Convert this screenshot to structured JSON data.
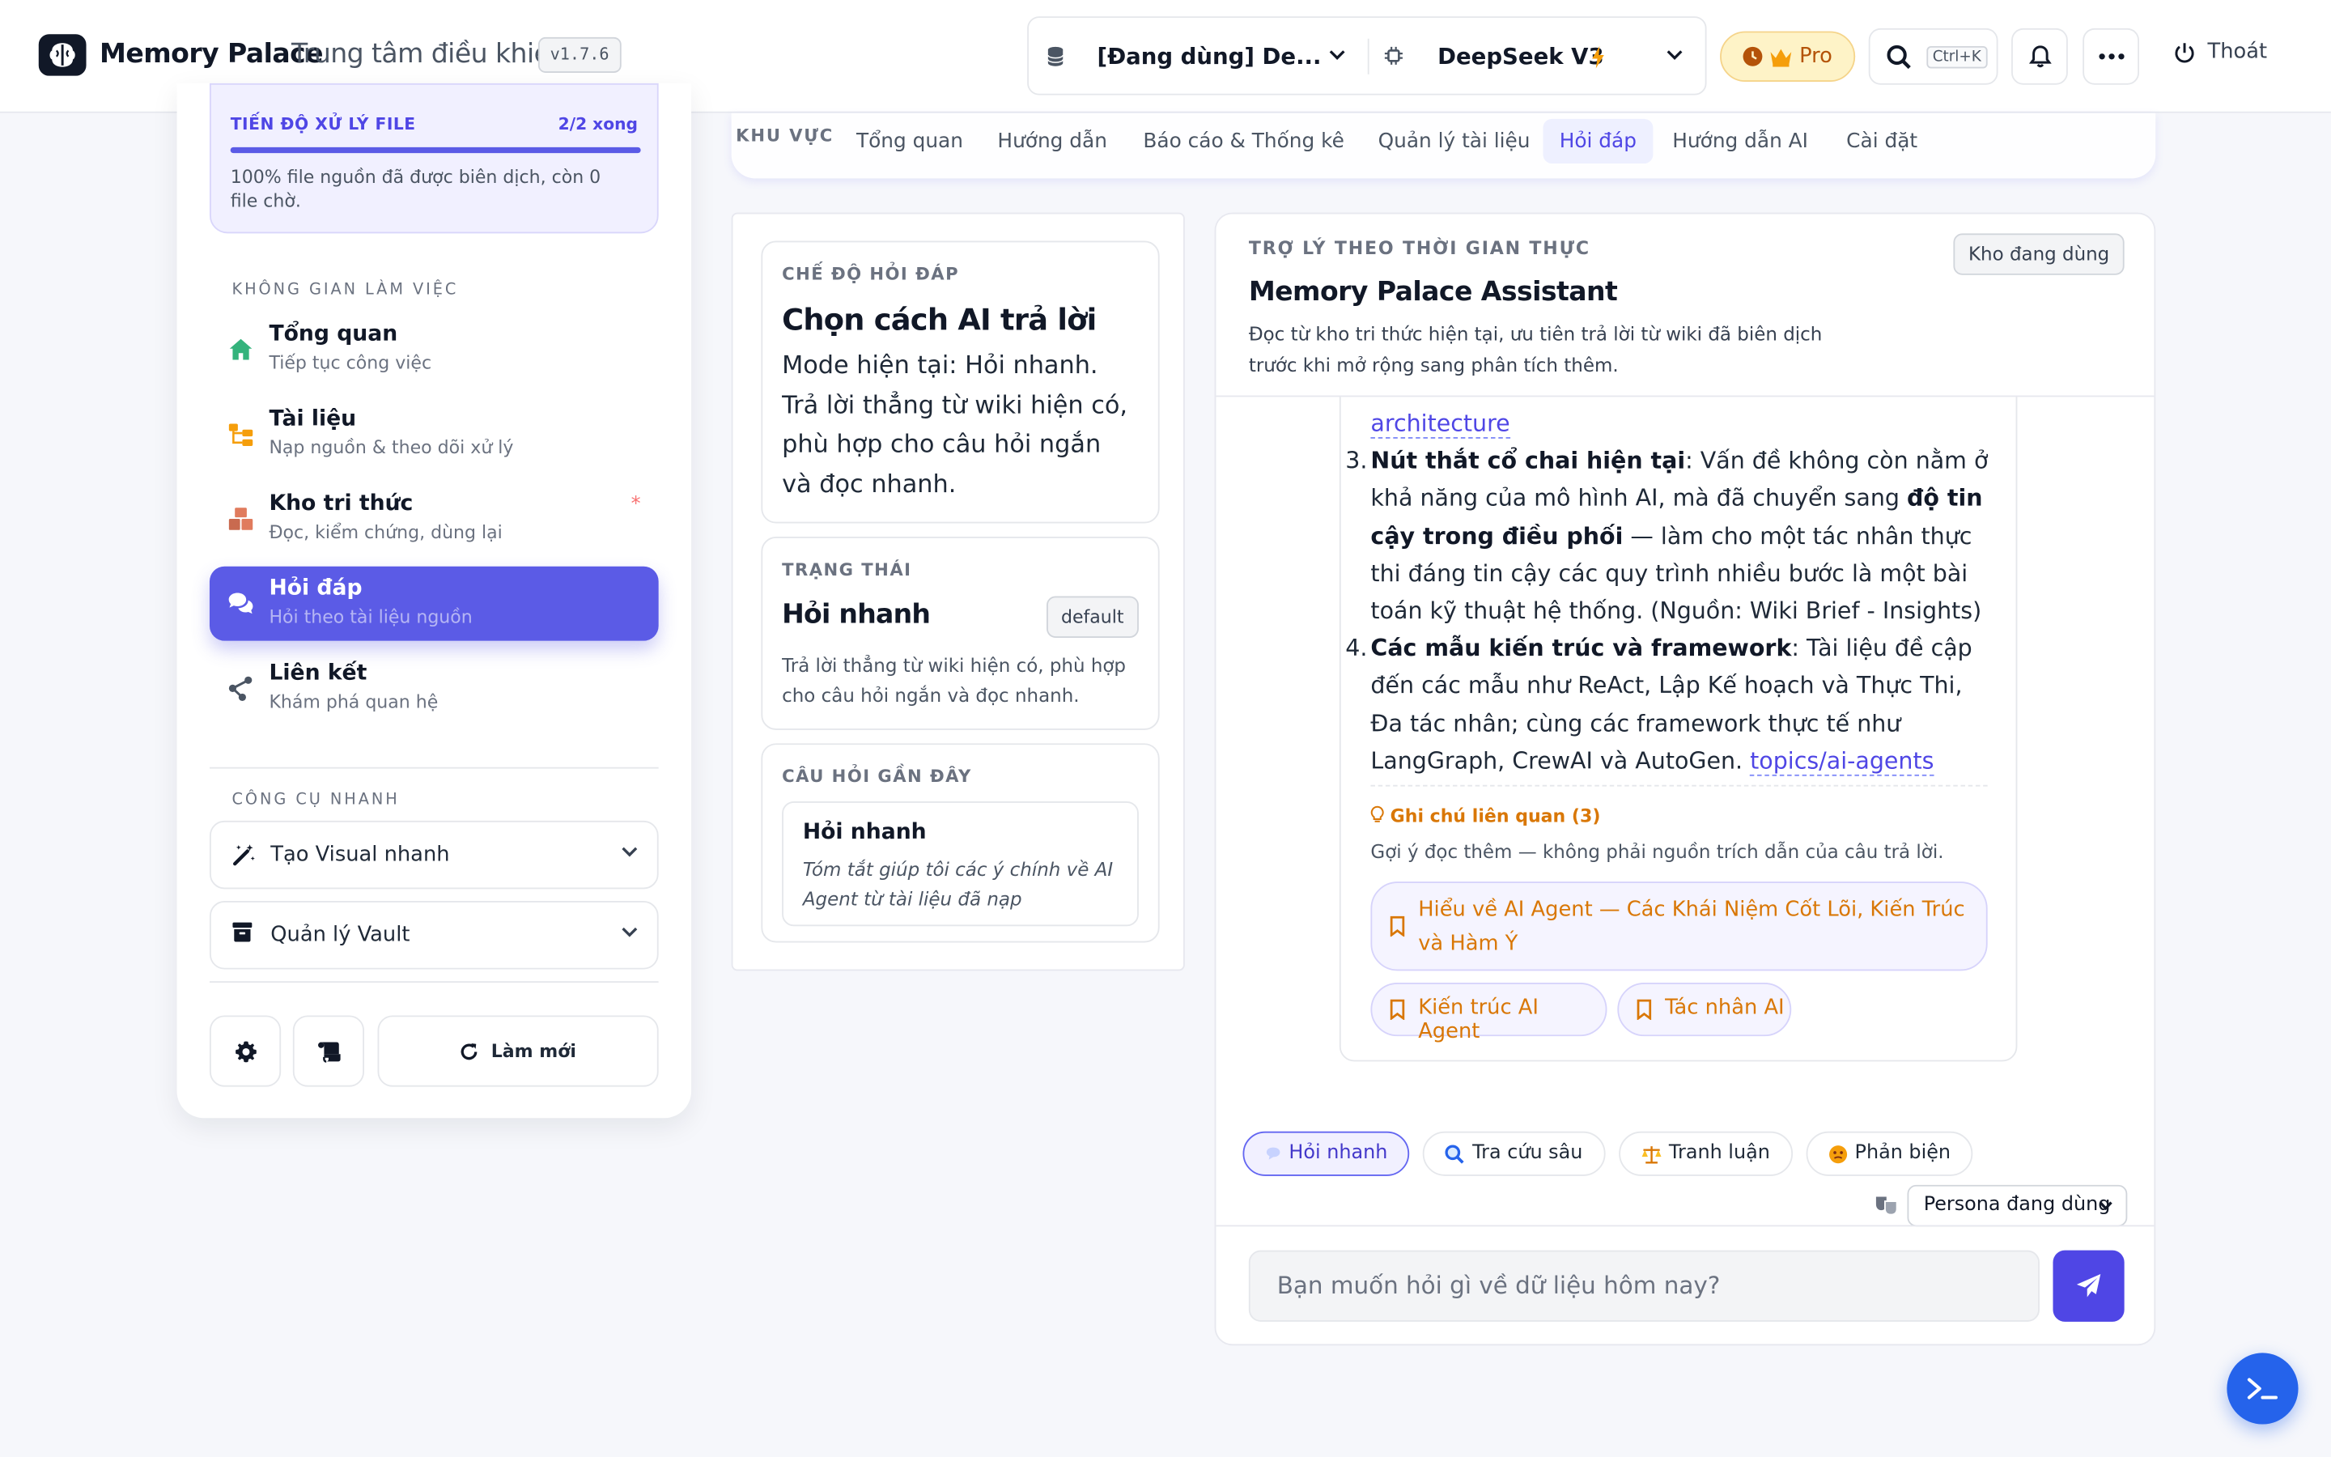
{
  "app": {
    "brand": "Memory Palace",
    "subtitle": "Trung tâm điều khiển",
    "version": "v1.7.6"
  },
  "header": {
    "vault_select": "[Đang dùng] De...",
    "model_select": "DeepSeek V3",
    "pro_label": "Pro",
    "search_shortcut": "Ctrl+K",
    "logout_label": "Thoát"
  },
  "topnav": {
    "section_label": "KHU VỰC",
    "tabs": [
      {
        "label": "Tổng quan"
      },
      {
        "label": "Hướng dẫn"
      },
      {
        "label": "Báo cáo & Thống kê"
      },
      {
        "label": "Quản lý tài liệu"
      },
      {
        "label": "Hỏi đáp"
      },
      {
        "label": "Hướng dẫn AI"
      },
      {
        "label": "Cài đặt"
      }
    ],
    "active_tab": "Hỏi đáp"
  },
  "sidebar": {
    "progress": {
      "title": "TIẾN ĐỘ XỬ LÝ FILE",
      "count": "2/2 xong",
      "fraction": 1.0,
      "description": "100% file nguồn đã được biên dịch, còn 0 file chờ."
    },
    "workspace_label": "KHÔNG GIAN LÀM VIỆC",
    "items": [
      {
        "title": "Tổng quan",
        "sub": "Tiếp tục công việc"
      },
      {
        "title": "Tài liệu",
        "sub": "Nạp nguồn & theo dõi xử lý"
      },
      {
        "title": "Kho tri thức",
        "sub": "Đọc, kiểm chứng, dùng lại",
        "flag": "*"
      },
      {
        "title": "Hỏi đáp",
        "sub": "Hỏi theo tài liệu nguồn"
      },
      {
        "title": "Liên kết",
        "sub": "Khám phá quan hệ"
      }
    ],
    "tools_label": "CÔNG CỤ NHANH",
    "tools": [
      {
        "label": "Tạo Visual nhanh"
      },
      {
        "label": "Quản lý Vault"
      }
    ],
    "refresh_label": "Làm mới"
  },
  "mode_panel": {
    "mode_card": {
      "caption": "CHẾ ĐỘ HỎI ĐÁP",
      "heading": "Chọn cách AI trả lời",
      "body": "Mode hiện tại: Hỏi nhanh. Trả lời thẳng từ wiki hiện có, phù hợp cho câu hỏi ngắn và đọc nhanh."
    },
    "status_card": {
      "caption": "TRẠNG THÁI",
      "heading": "Hỏi nhanh",
      "badge": "default",
      "body": "Trả lời thẳng từ wiki hiện có, phù hợp cho câu hỏi ngắn và đọc nhanh."
    },
    "recent_card": {
      "caption": "CÂU HỎI GẦN ĐÂY",
      "item_title": "Hỏi nhanh",
      "item_text": "Tóm tắt giúp tôi các ý chính về AI Agent từ tài liệu đã nạp"
    }
  },
  "chat": {
    "caption": "TRỢ LÝ THEO THỜI GIAN THỰC",
    "title": "Memory Palace Assistant",
    "description": "Đọc từ kho tri thức hiện tại, ưu tiên trả lời từ wiki đã biên dịch trước khi mở rộng sang phân tích thêm.",
    "badge": "Kho đang dùng",
    "message": {
      "overflow_link": "architecture",
      "items": [
        {
          "num": "3.",
          "lead": "Nút thắt cổ chai hiện tại",
          "t1": ": Vấn đề không còn nằm ở khả năng của mô hình AI, mà đã chuyển sang ",
          "bold2": "độ tin cậy trong điều phối",
          "t2": " — làm cho một tác nhân thực thi đáng tin cậy các quy trình nhiều bước là một bài toán kỹ thuật hệ thống. (Nguồn: Wiki Brief - Insights)"
        },
        {
          "num": "4.",
          "lead": "Các mẫu kiến trúc và framework",
          "t1": ": Tài liệu đề cập đến các mẫu như ReAct, Lập Kế hoạch và Thực Thi, Đa tác nhân; cùng các framework thực tế như LangGraph, CrewAI và AutoGen. ",
          "link": "topics/ai-agents"
        }
      ],
      "notes_title": "Ghi chú liên quan (3)",
      "notes_sub": "Gợi ý đọc thêm — không phải nguồn trích dẫn của câu trả lời.",
      "notes": [
        {
          "label": "Hiểu về AI Agent — Các Khái Niệm Cốt Lõi, Kiến Trúc và Hàm Ý"
        },
        {
          "label": "Kiến trúc AI Agent"
        },
        {
          "label": "Tác nhân AI"
        }
      ]
    },
    "modes": [
      {
        "label": "Hỏi nhanh",
        "icon": "speech-bubble"
      },
      {
        "label": "Tra cứu sâu",
        "icon": "magnifier"
      },
      {
        "label": "Tranh luận",
        "icon": "balance"
      },
      {
        "label": "Phản biện",
        "icon": "face"
      }
    ],
    "persona": "Persona đang dùng",
    "input_placeholder": "Bạn muốn hỏi gì về dữ liệu hôm nay?"
  },
  "colors": {
    "accent": "#5b5be6",
    "accent_dark": "#4f46e5",
    "note": "#d97706",
    "fab": "#2563eb"
  }
}
